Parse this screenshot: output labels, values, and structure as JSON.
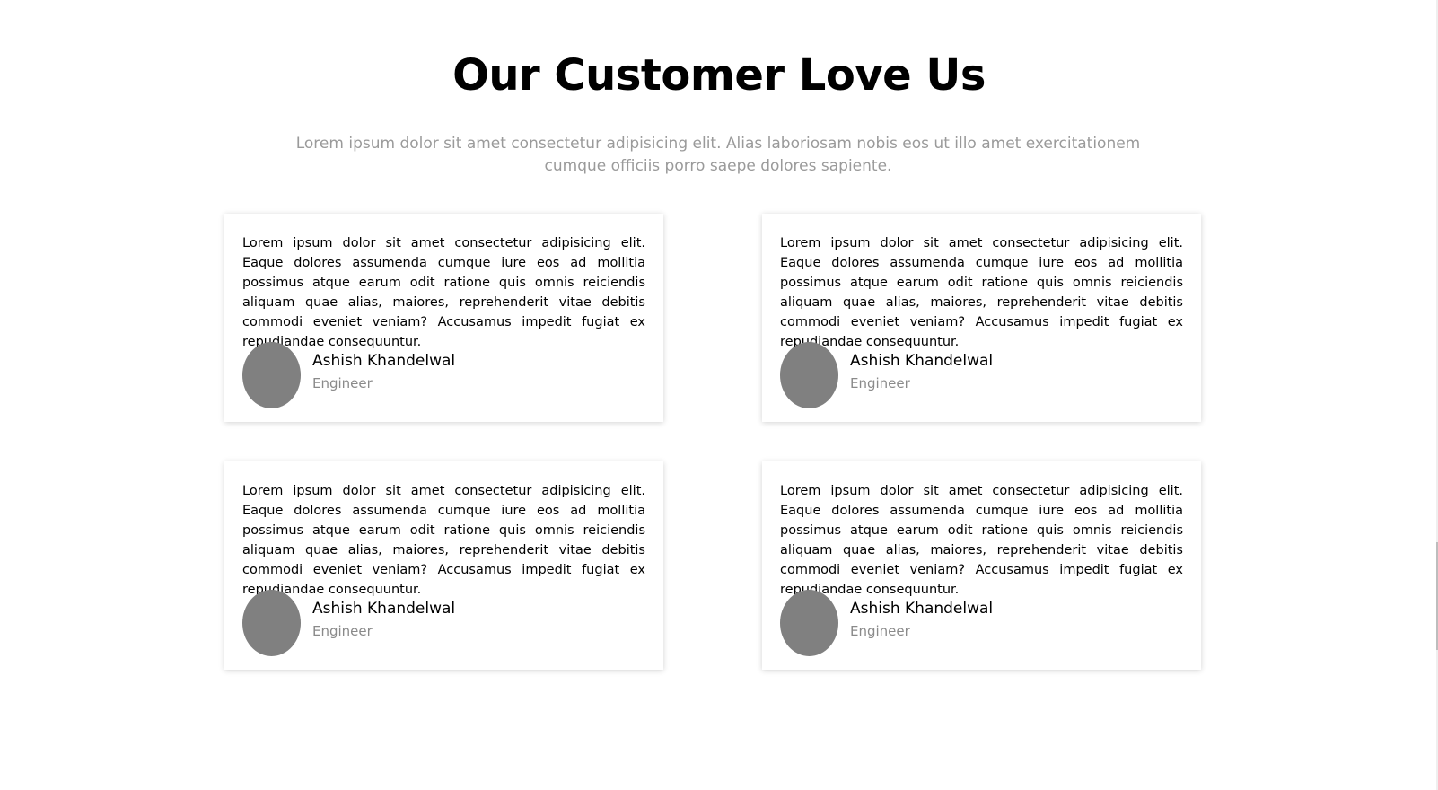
{
  "section": {
    "title": "Our Customer Love Us",
    "subtitle": "Lorem ipsum dolor sit amet consectetur adipisicing elit. Alias laboriosam nobis eos ut illo amet exercitationem cumque officiis porro saepe dolores sapiente."
  },
  "testimonials": [
    {
      "text": "Lorem ipsum dolor sit amet consectetur adipisicing elit. Eaque dolores assumenda cumque iure eos ad mollitia possimus atque earum odit ratione quis omnis reiciendis aliquam quae alias, maiores, reprehenderit vitae debitis commodi eveniet veniam? Accusamus impedit fugiat ex repudiandae consequuntur.",
      "name": "Ashish Khandelwal",
      "role": "Engineer"
    },
    {
      "text": "Lorem ipsum dolor sit amet consectetur adipisicing elit. Eaque dolores assumenda cumque iure eos ad mollitia possimus atque earum odit ratione quis omnis reiciendis aliquam quae alias, maiores, reprehenderit vitae debitis commodi eveniet veniam? Accusamus impedit fugiat ex repudiandae consequuntur.",
      "name": "Ashish Khandelwal",
      "role": "Engineer"
    },
    {
      "text": "Lorem ipsum dolor sit amet consectetur adipisicing elit. Eaque dolores assumenda cumque iure eos ad mollitia possimus atque earum odit ratione quis omnis reiciendis aliquam quae alias, maiores, reprehenderit vitae debitis commodi eveniet veniam? Accusamus impedit fugiat ex repudiandae consequuntur.",
      "name": "Ashish Khandelwal",
      "role": "Engineer"
    },
    {
      "text": "Lorem ipsum dolor sit amet consectetur adipisicing elit. Eaque dolores assumenda cumque iure eos ad mollitia possimus atque earum odit ratione quis omnis reiciendis aliquam quae alias, maiores, reprehenderit vitae debitis commodi eveniet veniam? Accusamus impedit fugiat ex repudiandae consequuntur.",
      "name": "Ashish Khandelwal",
      "role": "Engineer"
    }
  ],
  "colors": {
    "avatar": "#808080",
    "subtitle": "#9a9a9a",
    "role": "#8a8a8a"
  }
}
